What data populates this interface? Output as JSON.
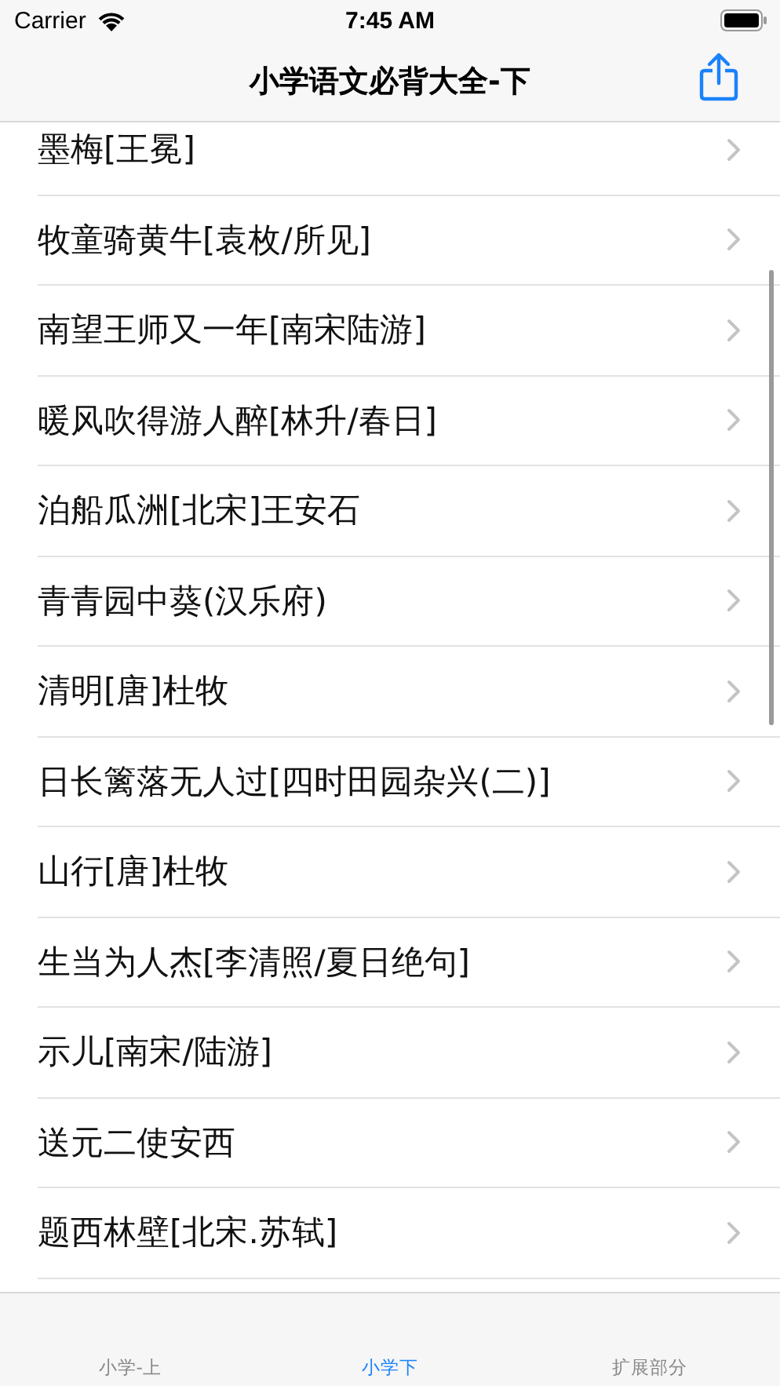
{
  "status_bar": {
    "carrier": "Carrier",
    "time": "7:45 AM"
  },
  "nav": {
    "title": "小学语文必背大全-下"
  },
  "rows": [
    {
      "title": "墨梅[王冕]"
    },
    {
      "title": "牧童骑黄牛[袁枚/所见]"
    },
    {
      "title": "南望王师又一年[南宋陆游]"
    },
    {
      "title": "暖风吹得游人醉[林升/春日]"
    },
    {
      "title": "泊船瓜洲[北宋]王安石"
    },
    {
      "title": "青青园中葵(汉乐府)"
    },
    {
      "title": "清明[唐]杜牧"
    },
    {
      "title": "日长篱落无人过[四时田园杂兴(二)]"
    },
    {
      "title": "山行[唐]杜牧"
    },
    {
      "title": "生当为人杰[李清照/夏日绝句]"
    },
    {
      "title": "示儿[南宋/陆游]"
    },
    {
      "title": "送元二使安西"
    },
    {
      "title": "题西林壁[北宋.苏轼]"
    }
  ],
  "tabs": [
    {
      "label": "小学-上",
      "selected": false
    },
    {
      "label": "小学下",
      "selected": true
    },
    {
      "label": "扩展部分",
      "selected": false
    }
  ]
}
